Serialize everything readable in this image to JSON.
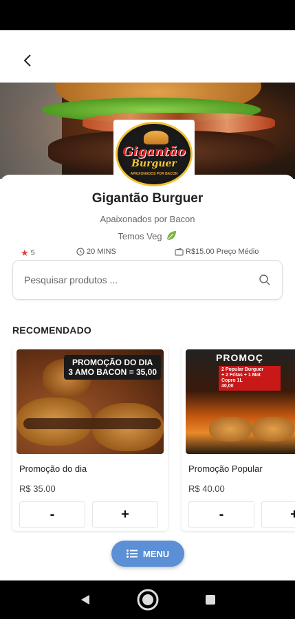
{
  "navigation": {
    "back_icon": "chevron-left-icon"
  },
  "logo": {
    "title": "Gigantão",
    "subtitle": "Burguer",
    "tagline": "APAIXONADOS POR BACON"
  },
  "shop": {
    "name": "Gigantão Burguer",
    "tagline": "Apaixonados por Bacon",
    "veg_label": "Temos Veg",
    "rating": "5",
    "time": "20 MINS",
    "price_label": "R$15.00 Preço Médio"
  },
  "search": {
    "placeholder": "Pesquisar produtos ..."
  },
  "section": {
    "title": "RECOMENDADO"
  },
  "products": [
    {
      "name": "Promoção do dia",
      "price": "R$ 35.00",
      "minus": "-",
      "plus": "+",
      "banner_line1": "PROMOÇÃO DO DIA",
      "banner_line2": "3 AMO BACON = 35,00"
    },
    {
      "name": "Promoção Popular",
      "price": "R$ 40.00",
      "minus": "-",
      "plus": "+",
      "banner_title": "PROMOÇ",
      "box_line1": "2 Popular Burguer",
      "box_line2": "+ 2 Fritas + 1 Mat",
      "box_line3": "Copro 1L",
      "box_line4": "40,00"
    }
  ],
  "menu_button": {
    "label": "MENU"
  },
  "colors": {
    "accent": "#5b8fd6",
    "star": "#e53935",
    "leaf": "#7cb342"
  }
}
